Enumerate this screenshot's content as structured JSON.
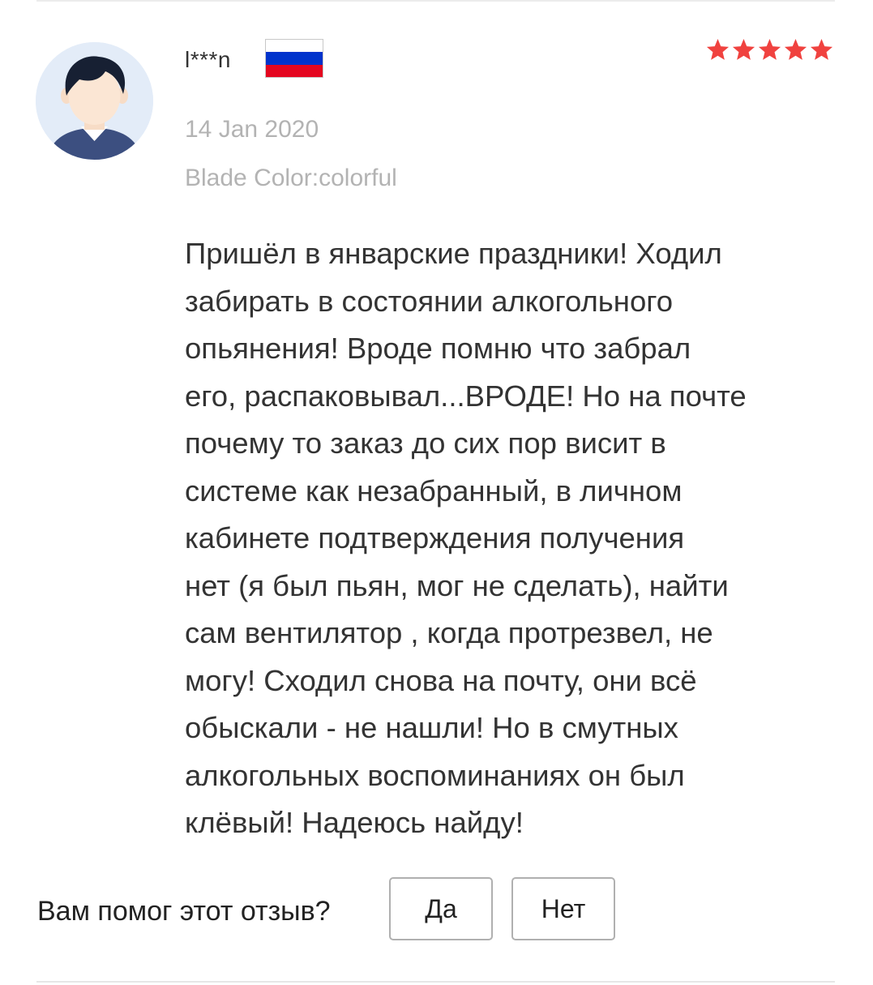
{
  "review": {
    "username": "l***n",
    "country_flag": {
      "name": "russia-flag",
      "colors": [
        "#ffffff",
        "#0033cc",
        "#e4061f"
      ]
    },
    "rating": 5,
    "rating_max": 5,
    "star_color": "#f0423f",
    "date": "14 Jan 2020",
    "sku": "Blade Color:colorful",
    "text": "Пришёл в январские праздники! Ходил\nзабирать в состоянии алкогольного\nопьянения! Вроде помню что забрал\nего, распаковывал...ВРОДЕ! Но на почте\nпочему то заказ до сих пор висит в\nсистеме как незабранный, в личном\nкабинете подтверждения получения\nнет (я был пьян, мог не сделать), найти\nсам вентилятор , когда протрезвел, не\nмогу! Сходил снова на почту, они всё\nобыскали - не нашли! Но в смутных\nалкогольных воспоминаниях он был\nклёвый! Надеюсь найду!"
  },
  "helpful": {
    "question": "Вам помог этот отзыв?",
    "yes_label": "Да",
    "no_label": "Нет"
  }
}
